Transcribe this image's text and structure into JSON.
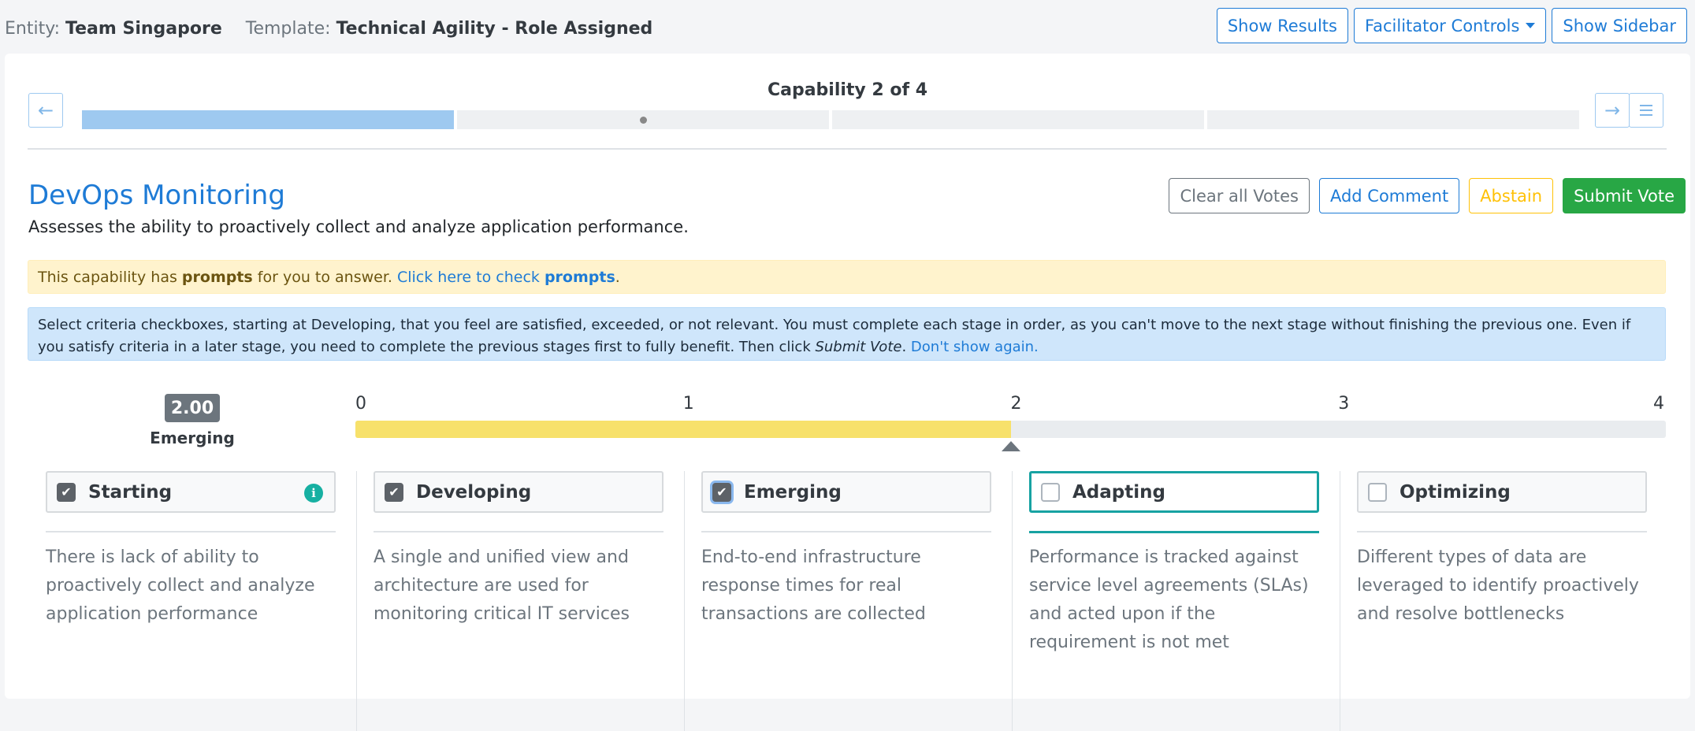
{
  "header": {
    "entity_label": "Entity:",
    "entity_value": "Team Singapore",
    "template_label": "Template:",
    "template_value": "Technical Agility - Role Assigned",
    "buttons": {
      "show_results": "Show Results",
      "facilitator_controls": "Facilitator Controls",
      "show_sidebar": "Show Sidebar"
    }
  },
  "progress": {
    "title": "Capability 2 of 4",
    "current": 2,
    "total": 4,
    "completed_segments": 1
  },
  "capability": {
    "name": "DevOps Monitoring",
    "description": "Assesses the ability to proactively collect and analyze application performance.",
    "actions": {
      "clear": "Clear all Votes",
      "comment": "Add Comment",
      "abstain": "Abstain",
      "submit": "Submit Vote"
    }
  },
  "alerts": {
    "prompts": {
      "text1": "This capability has ",
      "bold1": "prompts",
      "text2": " for you to answer. ",
      "link_text": "Click here to check ",
      "link_bold": "prompts",
      "end": "."
    },
    "instructions": {
      "text": "Select criteria checkboxes, starting at Developing, that you feel are satisfied, exceeded, or not relevant. You must complete each stage in order, as you can't move to the next stage without finishing the previous one. Even if you satisfy criteria in a later stage, you need to complete the previous stages first to fully benefit. Then click ",
      "emph": "Submit Vote",
      "end": ". ",
      "link": "Don't show again."
    }
  },
  "score": {
    "value": "2.00",
    "numeric": 2.0,
    "level": "Emerging",
    "scale_min": 0,
    "scale_max": 4,
    "ticks": [
      "0",
      "1",
      "2",
      "3",
      "4"
    ]
  },
  "stages": [
    {
      "label": "Starting",
      "checked": true,
      "info": true,
      "active": false,
      "text": "There is lack of ability to proactively collect and analyze application performance"
    },
    {
      "label": "Developing",
      "checked": true,
      "info": false,
      "active": false,
      "text": "A single and unified view and architecture are used for monitoring critical IT services"
    },
    {
      "label": "Emerging",
      "checked": true,
      "info": false,
      "active": false,
      "text": "End-to-end infrastructure response times for real transactions are collected"
    },
    {
      "label": "Adapting",
      "checked": false,
      "info": false,
      "active": true,
      "text": "Performance is tracked against service level agreements (SLAs) and acted upon if the requirement is not met"
    },
    {
      "label": "Optimizing",
      "checked": false,
      "info": false,
      "active": false,
      "text": "Different types of data are leveraged to identify proactively and resolve bottlenecks"
    }
  ],
  "colors": {
    "primary": "#1e7bd6",
    "success": "#28a745",
    "warning": "#ffc107",
    "teal": "#17a2a2",
    "score_fill": "#f7e16b"
  },
  "icons": {
    "prev": "arrow-left-icon",
    "next": "arrow-right-icon",
    "list": "list-ol-icon",
    "info": "info-circle-icon",
    "check": "check-icon"
  }
}
